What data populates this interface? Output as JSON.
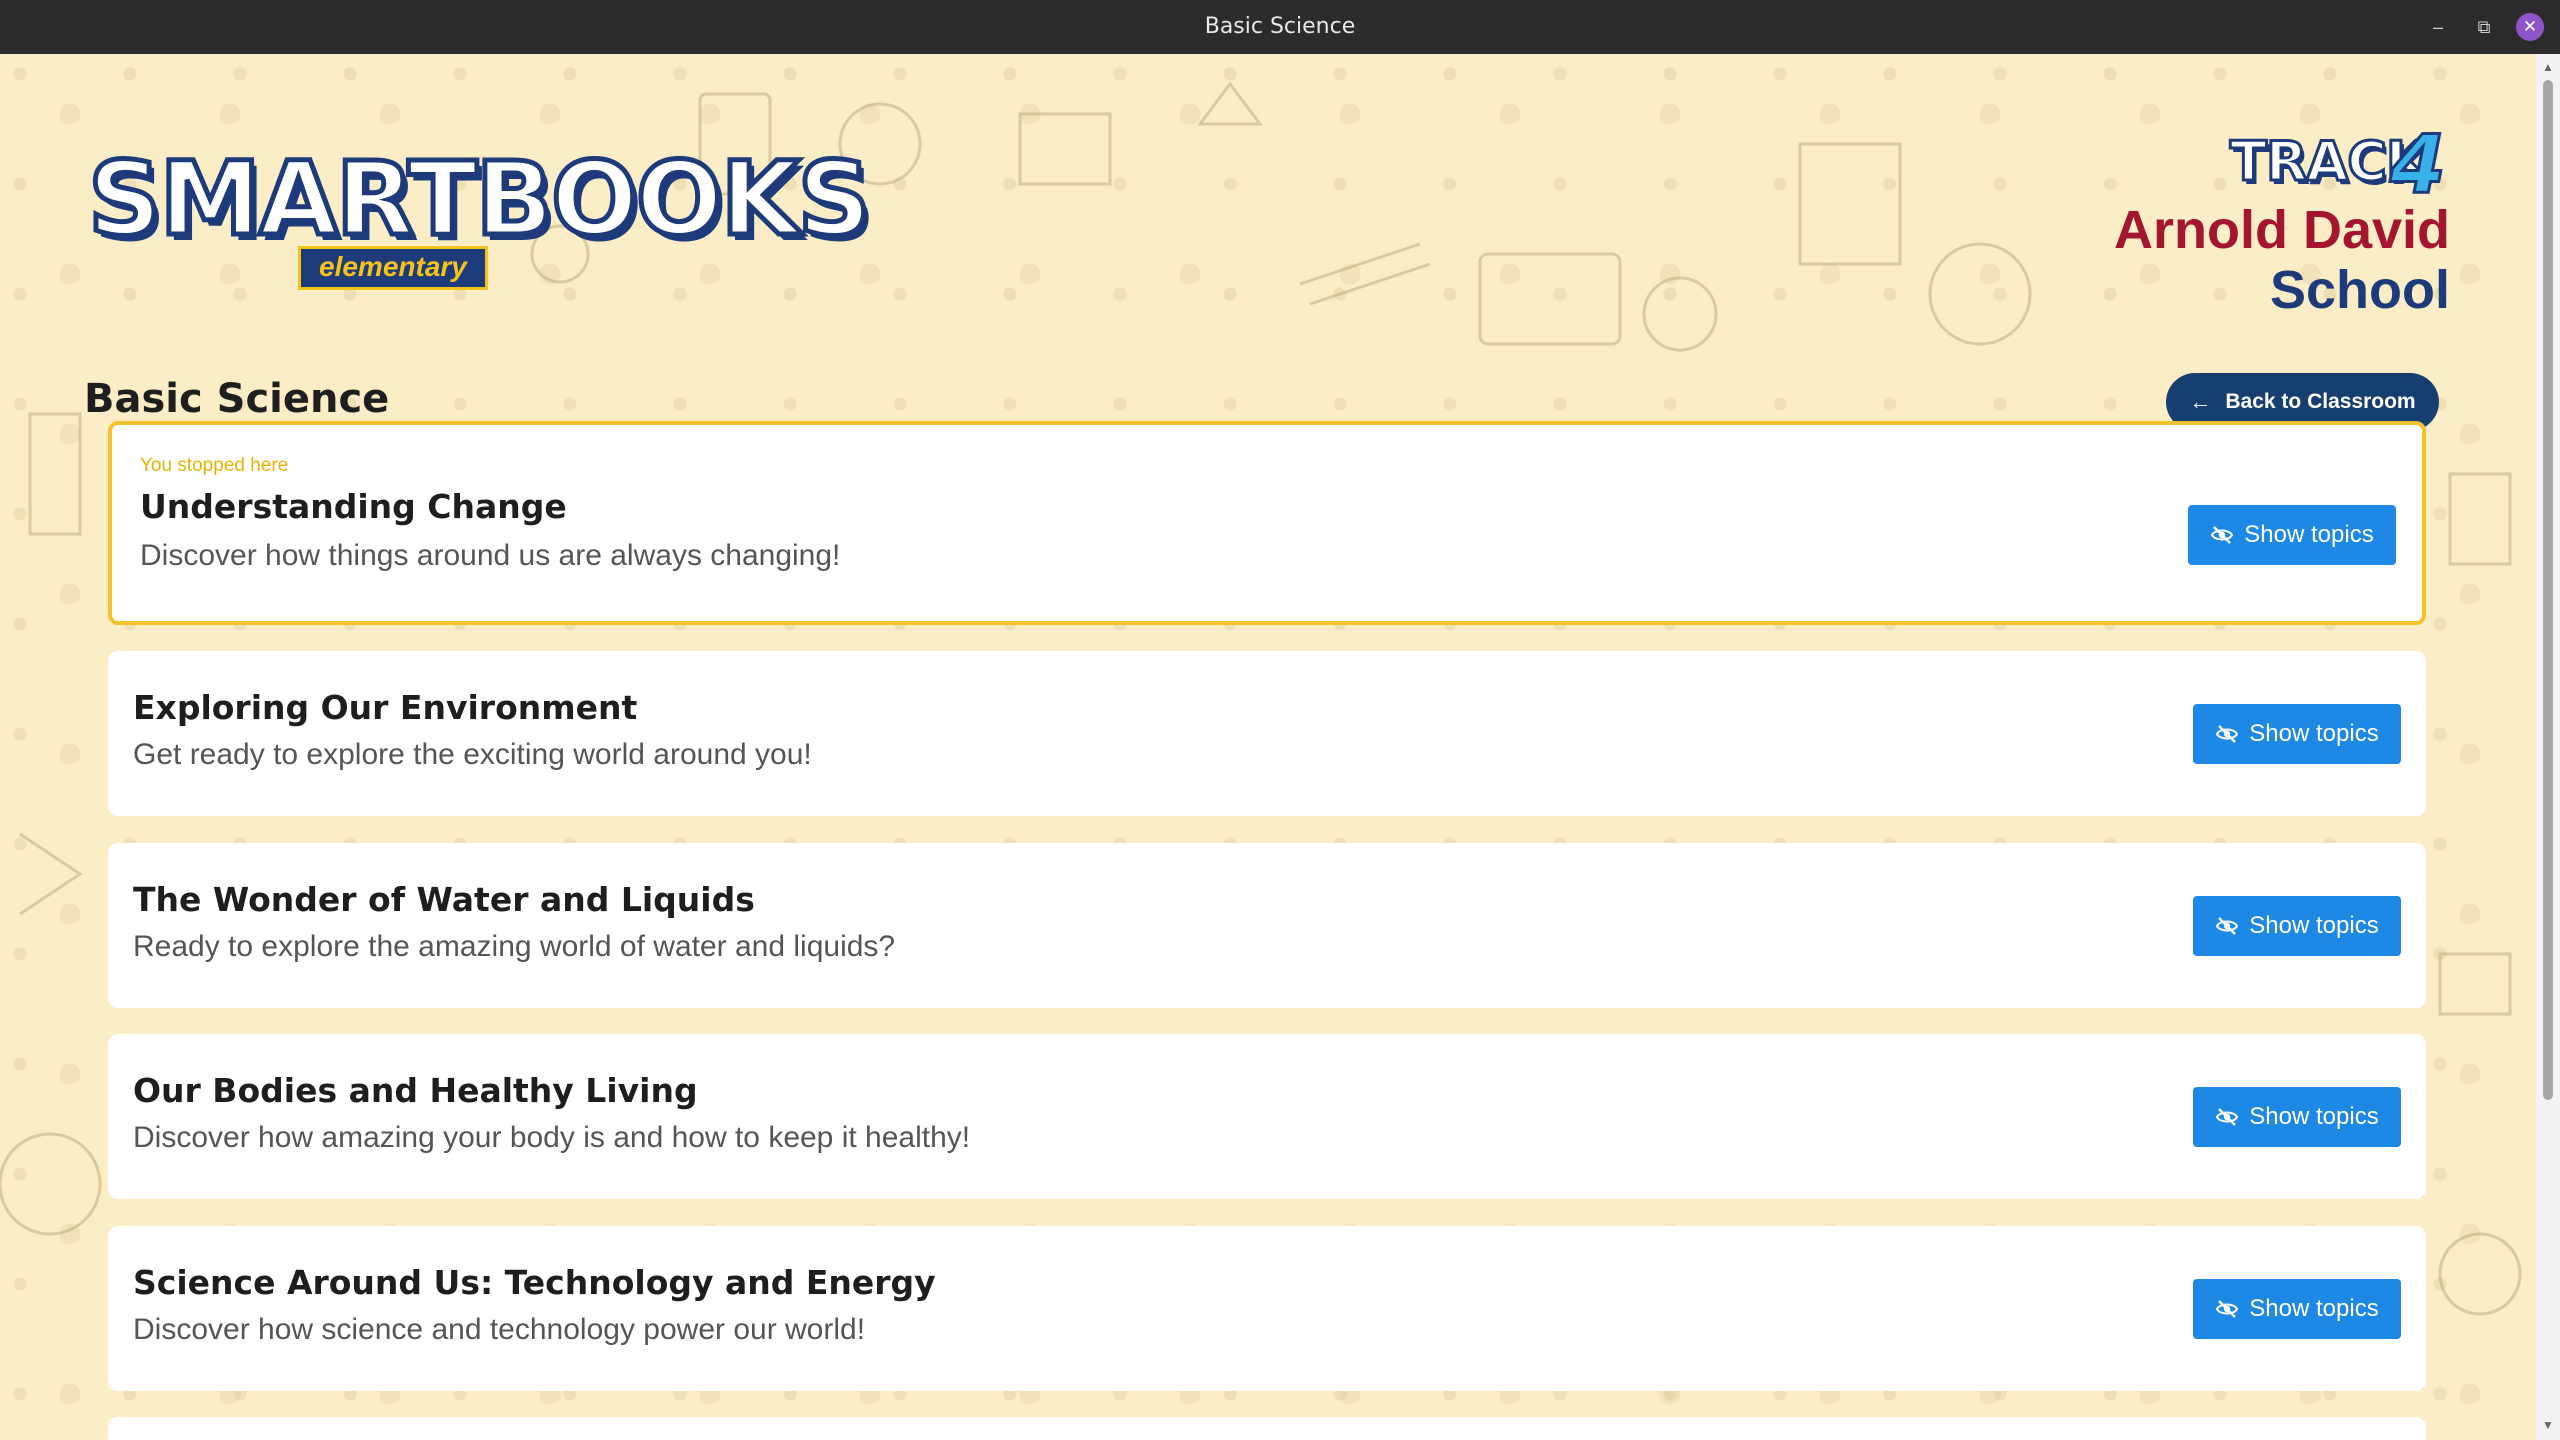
{
  "window": {
    "title": "Basic Science",
    "minimize_glyph": "–",
    "restore_glyph": "⧉",
    "close_glyph": "✕"
  },
  "brand": {
    "logo_text": "SMARTBOOKS",
    "logo_subtext": "elementary",
    "track_text": "TRACK",
    "track_number": "4"
  },
  "school": {
    "name_first": "Arnold David",
    "name_rest": "School"
  },
  "page": {
    "title": "Basic Science",
    "back_label": "Back to Classroom",
    "back_icon": "arrow-left-icon"
  },
  "colors": {
    "accent_blue": "#1e88e5",
    "navy": "#163e6e",
    "highlight_yellow": "#f4c22b",
    "school_red": "#a3162e"
  },
  "modules": [
    {
      "stopped_label": "You stopped here",
      "title": "Understanding Change",
      "description": "Discover how things around us are always changing!",
      "button_label": "Show topics",
      "button_icon": "eye-slash-icon"
    },
    {
      "title": "Exploring Our Environment",
      "description": "Get ready to explore the exciting world around you!",
      "button_label": "Show topics",
      "button_icon": "eye-slash-icon"
    },
    {
      "title": "The Wonder of Water and Liquids",
      "description": "Ready to explore the amazing world of water and liquids?",
      "button_label": "Show topics",
      "button_icon": "eye-slash-icon"
    },
    {
      "title": "Our Bodies and Healthy Living",
      "description": "Discover how amazing your body is and how to keep it healthy!",
      "button_label": "Show topics",
      "button_icon": "eye-slash-icon"
    },
    {
      "title": "Science Around Us: Technology and Energy",
      "description": "Discover how science and technology power our world!",
      "button_label": "Show topics",
      "button_icon": "eye-slash-icon"
    }
  ]
}
